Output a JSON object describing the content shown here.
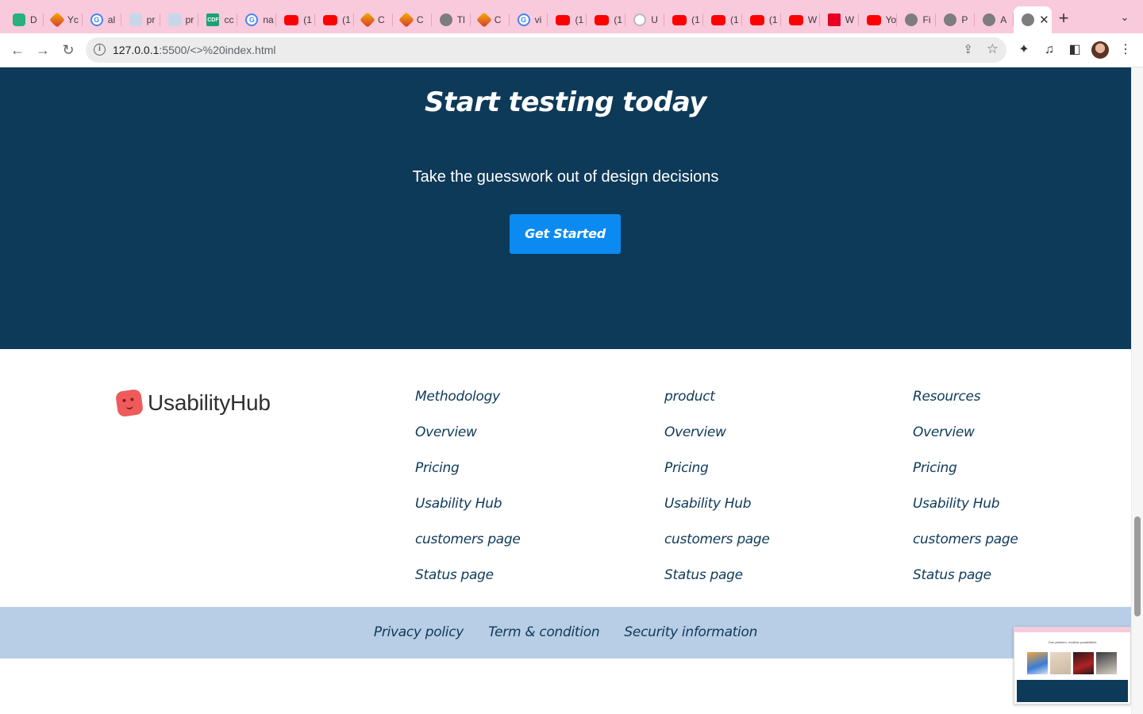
{
  "browser": {
    "tabs": [
      {
        "icon": "shield-icon",
        "label": "D"
      },
      {
        "icon": "gem-icon",
        "label": "Yc"
      },
      {
        "icon": "google-icon",
        "label": "al"
      },
      {
        "icon": "bars-icon",
        "label": "pr"
      },
      {
        "icon": "bars-icon",
        "label": "pr"
      },
      {
        "icon": "cdf-icon",
        "label": "cc"
      },
      {
        "icon": "google-icon",
        "label": "na"
      },
      {
        "icon": "youtube-icon",
        "label": "(1"
      },
      {
        "icon": "youtube-icon",
        "label": "(1"
      },
      {
        "icon": "gem-icon",
        "label": "C"
      },
      {
        "icon": "gem-icon",
        "label": "C"
      },
      {
        "icon": "globe-icon",
        "label": "Tl"
      },
      {
        "icon": "gem-icon",
        "label": "C"
      },
      {
        "icon": "google-icon",
        "label": "vi"
      },
      {
        "icon": "youtube-icon",
        "label": "(1"
      },
      {
        "icon": "youtube-icon",
        "label": "(1"
      },
      {
        "icon": "github-icon",
        "label": "U"
      },
      {
        "icon": "youtube-icon",
        "label": "(1"
      },
      {
        "icon": "youtube-icon",
        "label": "(1"
      },
      {
        "icon": "youtube-icon",
        "label": "(1"
      },
      {
        "icon": "youtube-icon",
        "label": "W"
      },
      {
        "icon": "pinterest-icon",
        "label": "W"
      },
      {
        "icon": "youtube-icon",
        "label": "Yo"
      },
      {
        "icon": "globe-icon",
        "label": "Fi"
      },
      {
        "icon": "globe-icon",
        "label": "P"
      },
      {
        "icon": "globe-icon",
        "label": "A"
      }
    ],
    "active_tab_close": "✕",
    "new_tab": "+",
    "address": {
      "host": "127.0.0.1",
      "path": ":5500/<>%20index.html"
    }
  },
  "cta": {
    "title": "Start testing today",
    "subtitle": "Take the guesswork out of design decisions",
    "button": "Get Started"
  },
  "footer": {
    "brand": "UsabilityHub",
    "columns": [
      {
        "heading": "Methodology",
        "links": [
          "Overview",
          "Pricing",
          "Usability Hub",
          "customers page",
          "Status page"
        ]
      },
      {
        "heading": "product",
        "links": [
          "Overview",
          "Pricing",
          "Usability Hub",
          "customers page",
          "Status page"
        ]
      },
      {
        "heading": "Resources",
        "links": [
          "Overview",
          "Pricing",
          "Usability Hub",
          "customers page",
          "Status page"
        ]
      }
    ],
    "legal": [
      "Privacy policy",
      "Term & condition",
      "Security information"
    ]
  },
  "thumbnail": {
    "title": "One platform, endless possibilities"
  },
  "colors": {
    "cta_bg": "#0e3a59",
    "button_bg": "#0b8bf2",
    "legal_bg": "#b8cde6",
    "tabstrip_bg": "#f9c9dc",
    "brand_red": "#ef5b5b"
  }
}
